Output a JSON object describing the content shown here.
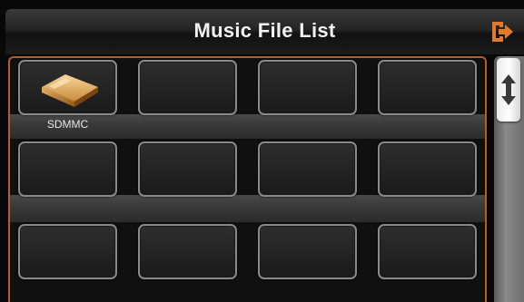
{
  "header": {
    "title": "Music File List",
    "exit_icon": "exit-icon"
  },
  "colors": {
    "accent": "#e07a2e",
    "panel_border": "#b45d29",
    "tile_border": "#8a8a8a",
    "title_text": "#f2f2f2"
  },
  "grid": {
    "rows": 3,
    "columns": 4,
    "items": [
      {
        "label": "SDMMC",
        "icon": "folder-icon"
      },
      {
        "label": ""
      },
      {
        "label": ""
      },
      {
        "label": ""
      },
      {
        "label": ""
      },
      {
        "label": ""
      },
      {
        "label": ""
      },
      {
        "label": ""
      },
      {
        "label": ""
      },
      {
        "label": ""
      },
      {
        "label": ""
      },
      {
        "label": ""
      }
    ]
  },
  "scrollbar": {
    "icon": "up-down-arrow-icon"
  }
}
